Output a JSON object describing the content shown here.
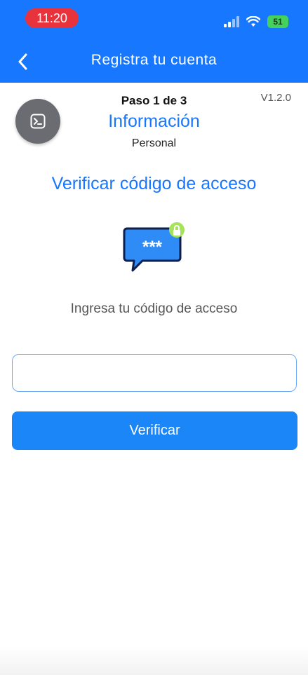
{
  "status_bar": {
    "time": "11:20",
    "battery": "51",
    "icons": [
      "signal-icon",
      "wifi-icon",
      "battery-icon"
    ]
  },
  "nav": {
    "title": "Registra tu cuenta",
    "back_icon": "chevron-left-icon"
  },
  "step": {
    "label": "Paso 1 de 3",
    "title": "Información",
    "subtitle": "Personal",
    "version": "V1.2.0",
    "avatar_icon": "terminal-icon"
  },
  "main": {
    "heading": "Verificar código de acceso",
    "illustration_text": "***",
    "illustration_icon": "locked-message-icon",
    "prompt": "Ingresa tu código de acceso",
    "input_value": "",
    "input_placeholder": "",
    "button_label": "Verificar"
  },
  "colors": {
    "primary": "#1877ff",
    "button": "#1a86f7",
    "time_pill": "#e9333c",
    "battery": "#44d15c",
    "avatar": "#6b6b72"
  }
}
